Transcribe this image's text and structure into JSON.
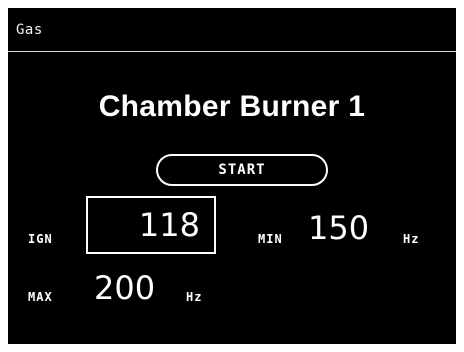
{
  "header": {
    "title": "Gas"
  },
  "main": {
    "title": "Chamber Burner 1",
    "start_label": "START",
    "ign": {
      "label": "IGN",
      "value": "118"
    },
    "min": {
      "label": "MIN",
      "value": "150",
      "unit": "Hz"
    },
    "max": {
      "label": "MAX",
      "value": "200",
      "unit": "Hz"
    }
  },
  "colors": {
    "background": "#000000",
    "foreground": "#ffffff"
  }
}
